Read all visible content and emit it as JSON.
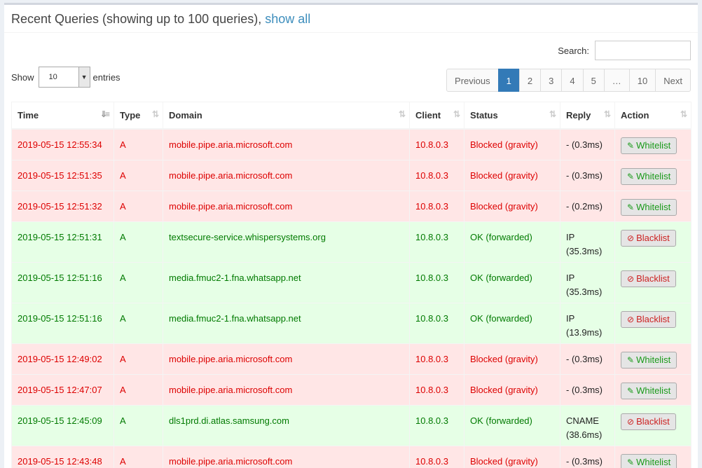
{
  "header": {
    "title": "Recent Queries (showing up to 100 queries),",
    "show_all": "show all"
  },
  "search": {
    "label": "Search:",
    "value": ""
  },
  "length": {
    "show_label": "Show",
    "value": "10",
    "entries_label": "entries"
  },
  "pagination": {
    "previous": "Previous",
    "pages": [
      "1",
      "2",
      "3",
      "4",
      "5",
      "…",
      "10"
    ],
    "active": "1",
    "next": "Next"
  },
  "columns": [
    "Time",
    "Type",
    "Domain",
    "Client",
    "Status",
    "Reply",
    "Action"
  ],
  "colors": {
    "blocked_bg": "#ffe6e6",
    "blocked_text": "#dd0000",
    "ok_bg": "#e6ffe6",
    "ok_text": "#007a00",
    "page_active": "#337ab7"
  },
  "rows": [
    {
      "time": "2019-05-15 12:55:34",
      "type": "A",
      "domain": "mobile.pipe.aria.microsoft.com",
      "client": "10.8.0.3",
      "status": "Blocked (gravity)",
      "reply": "- (0.3ms)",
      "action": "Whitelist",
      "kind": "blocked"
    },
    {
      "time": "2019-05-15 12:51:35",
      "type": "A",
      "domain": "mobile.pipe.aria.microsoft.com",
      "client": "10.8.0.3",
      "status": "Blocked (gravity)",
      "reply": "- (0.3ms)",
      "action": "Whitelist",
      "kind": "blocked"
    },
    {
      "time": "2019-05-15 12:51:32",
      "type": "A",
      "domain": "mobile.pipe.aria.microsoft.com",
      "client": "10.8.0.3",
      "status": "Blocked (gravity)",
      "reply": "- (0.2ms)",
      "action": "Whitelist",
      "kind": "blocked"
    },
    {
      "time": "2019-05-15 12:51:31",
      "type": "A",
      "domain": "textsecure-service.whispersystems.org",
      "client": "10.8.0.3",
      "status": "OK (forwarded)",
      "reply": "IP (35.3ms)",
      "action": "Blacklist",
      "kind": "ok"
    },
    {
      "time": "2019-05-15 12:51:16",
      "type": "A",
      "domain": "media.fmuc2-1.fna.whatsapp.net",
      "client": "10.8.0.3",
      "status": "OK (forwarded)",
      "reply": "IP (35.3ms)",
      "action": "Blacklist",
      "kind": "ok"
    },
    {
      "time": "2019-05-15 12:51:16",
      "type": "A",
      "domain": "media.fmuc2-1.fna.whatsapp.net",
      "client": "10.8.0.3",
      "status": "OK (forwarded)",
      "reply": "IP (13.9ms)",
      "action": "Blacklist",
      "kind": "ok"
    },
    {
      "time": "2019-05-15 12:49:02",
      "type": "A",
      "domain": "mobile.pipe.aria.microsoft.com",
      "client": "10.8.0.3",
      "status": "Blocked (gravity)",
      "reply": "- (0.3ms)",
      "action": "Whitelist",
      "kind": "blocked"
    },
    {
      "time": "2019-05-15 12:47:07",
      "type": "A",
      "domain": "mobile.pipe.aria.microsoft.com",
      "client": "10.8.0.3",
      "status": "Blocked (gravity)",
      "reply": "- (0.3ms)",
      "action": "Whitelist",
      "kind": "blocked"
    },
    {
      "time": "2019-05-15 12:45:09",
      "type": "A",
      "domain": "dls1prd.di.atlas.samsung.com",
      "client": "10.8.0.3",
      "status": "OK (forwarded)",
      "reply": "CNAME (38.6ms)",
      "action": "Blacklist",
      "kind": "ok"
    },
    {
      "time": "2019-05-15 12:43:48",
      "type": "A",
      "domain": "mobile.pipe.aria.microsoft.com",
      "client": "10.8.0.3",
      "status": "Blocked (gravity)",
      "reply": "- (0.3ms)",
      "action": "Whitelist",
      "kind": "blocked"
    }
  ]
}
